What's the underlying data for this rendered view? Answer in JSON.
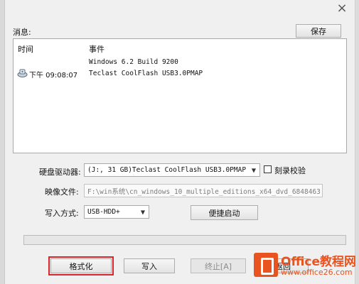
{
  "window": {
    "close_glyph": "×"
  },
  "messages": {
    "label": "消息:",
    "save_button": "保存",
    "columns": [
      "时间",
      "事件"
    ],
    "rows": [
      {
        "time": "",
        "event": "Windows 6.2 Build 9200",
        "has_icon": false
      },
      {
        "time": "下午 09:08:07",
        "event": "Teclast CoolFlash USB3.0PMAP",
        "has_icon": true
      }
    ]
  },
  "drive": {
    "label": "硬盘驱动器:",
    "selected": "(J:, 31 GB)Teclast CoolFlash USB3.0PMAP",
    "verify_label": "刻录校验",
    "verify_checked": false
  },
  "image_file": {
    "label": "映像文件:",
    "value": "F:\\win系统\\cn_windows_10_multiple_editions_x64_dvd_6848463."
  },
  "write_mode": {
    "label": "写入方式:",
    "selected": "USB-HDD+",
    "quick_boot_button": "便捷启动"
  },
  "progress": {
    "value": 0
  },
  "actions": {
    "format_button": "格式化",
    "write_button": "写入",
    "abort_button": "终止[A]",
    "return_button": "返回"
  },
  "watermark": {
    "brand": "Office教程网",
    "url": "www.office26.com",
    "color": "#e8531f"
  },
  "colors": {
    "highlight_border": "#d8262b"
  }
}
